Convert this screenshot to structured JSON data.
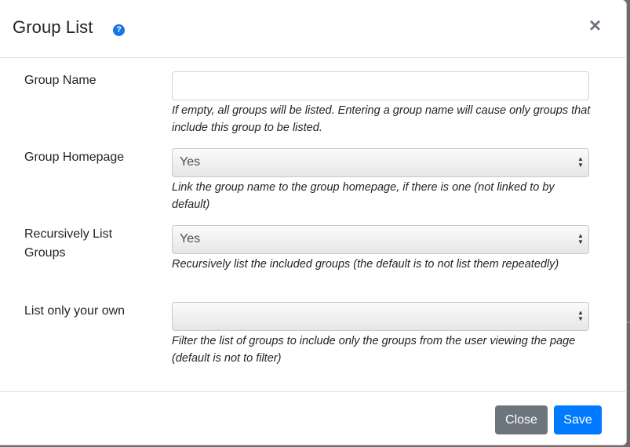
{
  "dialog": {
    "title": "Group List",
    "help_icon": "question-circle-icon",
    "close_glyph": "×"
  },
  "fields": [
    {
      "label": "Group Name",
      "type": "text",
      "value": "",
      "placeholder": "",
      "help": "If empty, all groups will be listed. Entering a group name will cause only groups that include this group to be listed."
    },
    {
      "label": "Group Homepage",
      "type": "select",
      "value": "Yes",
      "help": "Link the group name to the group homepage, if there is one (not linked to by default)"
    },
    {
      "label": "Recursively List Groups",
      "type": "select",
      "value": "Yes",
      "help": "Recursively list the included groups (the default is to not list them repeatedly)"
    },
    {
      "label": "List only your own",
      "type": "select",
      "value": "",
      "help": "Filter the list of groups to include only the groups from the user viewing the page (default is not to filter)"
    }
  ],
  "footer": {
    "close_label": "Close",
    "save_label": "Save"
  },
  "colors": {
    "primary": "#007bff",
    "secondary": "#6c757d",
    "help_icon": "#1a73e8"
  }
}
